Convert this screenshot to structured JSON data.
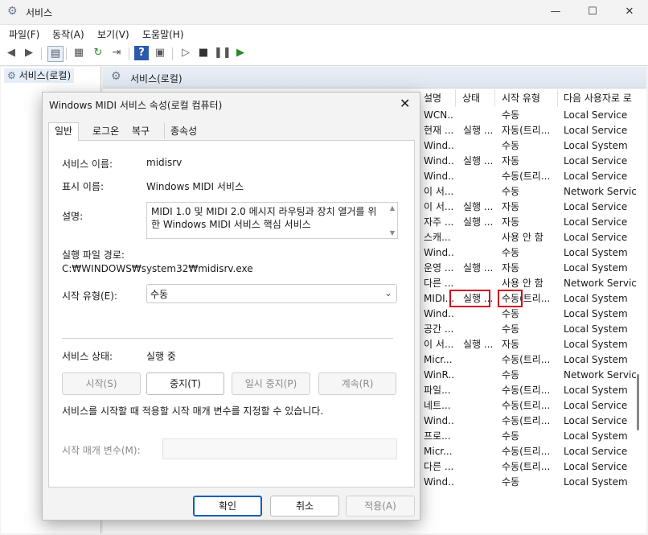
{
  "window": {
    "title": "서비스",
    "minimize": "—",
    "maximize": "☐",
    "close": "✕"
  },
  "menu": [
    "파일(F)",
    "동작(A)",
    "보기(V)",
    "도움말(H)"
  ],
  "tree": {
    "item": "서비스(로컬)"
  },
  "right": {
    "header": "서비스(로컬)",
    "columns": [
      "설명",
      "상태",
      "시작 유형",
      "다음 사용자로 로"
    ],
    "rows": [
      [
        "WCN...",
        "",
        "수동",
        "Local Service"
      ],
      [
        "현재 ...",
        "실행 ...",
        "자동(트리...",
        "Local Service"
      ],
      [
        "Wind...",
        "",
        "수동",
        "Local System"
      ],
      [
        "Wind...",
        "실행 ...",
        "자동",
        "Local Service"
      ],
      [
        "Wind...",
        "",
        "수동(트리...",
        "Local Service"
      ],
      [
        "이 서...",
        "",
        "수동",
        "Network Service"
      ],
      [
        "이 서...",
        "실행 ...",
        "자동",
        "Local Service"
      ],
      [
        "자주 ...",
        "실행 ...",
        "자동",
        "Local Service"
      ],
      [
        "스캐...",
        "",
        "사용 안 함",
        "Local Service"
      ],
      [
        "Wind...",
        "",
        "수동",
        "Local System"
      ],
      [
        "운영 ...",
        "실행 ...",
        "자동",
        "Local System"
      ],
      [
        "다른 ...",
        "",
        "사용 안 함",
        "Network Service"
      ],
      [
        "MIDI...",
        "실행 ...",
        "수동(트리...",
        "Local System"
      ],
      [
        "Wind...",
        "",
        "수동",
        "Local System"
      ],
      [
        "공간 ...",
        "",
        "수동",
        "Local System"
      ],
      [
        "이 서...",
        "실행 ...",
        "자동",
        "Local System"
      ],
      [
        "Micr...",
        "",
        "수동(트리...",
        "Local System"
      ],
      [
        "WinR...",
        "",
        "수동",
        "Network Service"
      ],
      [
        "파일...",
        "",
        "수동(트리...",
        "Local System"
      ],
      [
        "네트...",
        "",
        "수동(트리...",
        "Local Service"
      ],
      [
        "Wind...",
        "",
        "수동(트리...",
        "Local Service"
      ],
      [
        "프로...",
        "",
        "수동",
        "Local System"
      ],
      [
        "Micr...",
        "",
        "수동(트리...",
        "Local Service"
      ],
      [
        "다른 ...",
        "",
        "수동(트리...",
        "Local Service"
      ],
      [
        "Wind...",
        "",
        "수동",
        "Local System"
      ]
    ]
  },
  "dialog": {
    "title": "Windows MIDI 서비스 속성(로컬 컴퓨터)",
    "tabs": [
      "일반",
      "로그온",
      "복구",
      "종속성"
    ],
    "service_name_label": "서비스 이름:",
    "service_name": "midisrv",
    "display_name_label": "표시 이름:",
    "display_name": "Windows MIDI 서비스",
    "description_label": "설명:",
    "description": "MIDI 1.0 및 MIDI 2.0 메시지 라우팅과 장치 열거를 위한 Windows MIDI 서비스 핵심 서비스",
    "path_label": "실행 파일 경로:",
    "path": "C:₩WINDOWS₩system32₩midisrv.exe",
    "startup_type_label": "시작 유형(E):",
    "startup_type": "수동",
    "status_label": "서비스 상태:",
    "status": "실행 중",
    "btn_start": "시작(S)",
    "btn_stop": "중지(T)",
    "btn_pause": "일시 중지(P)",
    "btn_resume": "계속(R)",
    "params_hint": "서비스를 시작할 때 적용할 시작 매개 변수를 지정할 수 있습니다.",
    "params_label": "시작 매개 변수(M):",
    "params_value": "",
    "ok": "확인",
    "cancel": "취소",
    "apply": "적용(A)"
  }
}
